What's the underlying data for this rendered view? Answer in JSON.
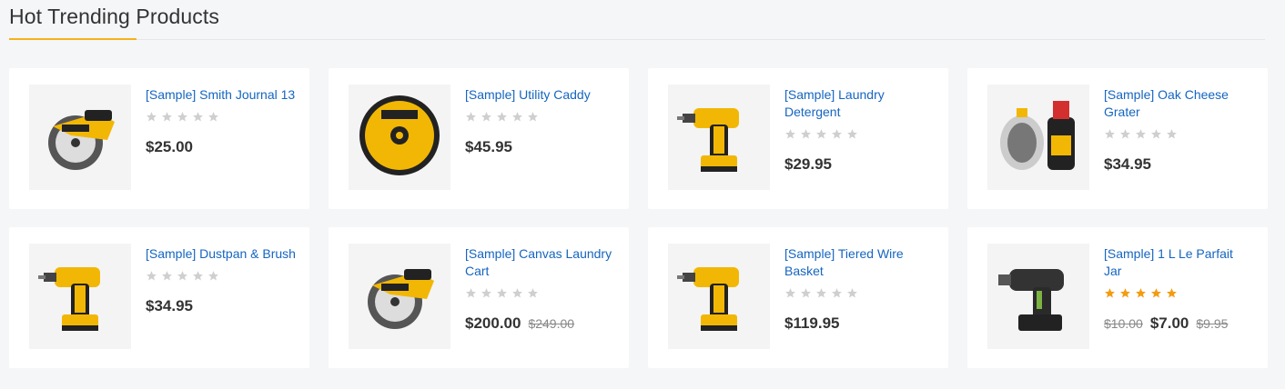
{
  "section": {
    "title": "Hot Trending Products",
    "accent_color": "#f5b21b"
  },
  "colors": {
    "link": "#1565c0",
    "star_empty": "#cfcfcf",
    "star_filled": "#f39c12"
  },
  "products": [
    {
      "name": "[Sample] Smith Journal 13",
      "rating": 0,
      "price": "$25.00",
      "old_price_before": "",
      "old_price_after": "",
      "image": "circular-saw-icon"
    },
    {
      "name": "[Sample] Utility Caddy",
      "rating": 0,
      "price": "$45.95",
      "old_price_before": "",
      "old_price_after": "",
      "image": "saw-blade-icon"
    },
    {
      "name": "[Sample] Laundry Detergent",
      "rating": 0,
      "price": "$29.95",
      "old_price_before": "",
      "old_price_after": "",
      "image": "hammer-drill-icon"
    },
    {
      "name": "[Sample] Oak Cheese Grater",
      "rating": 0,
      "price": "$34.95",
      "old_price_before": "",
      "old_price_after": "",
      "image": "chalk-line-icon"
    },
    {
      "name": "[Sample] Dustpan & Brush",
      "rating": 0,
      "price": "$34.95",
      "old_price_before": "",
      "old_price_after": "",
      "image": "hammer-drill-icon"
    },
    {
      "name": "[Sample] Canvas Laundry Cart",
      "rating": 0,
      "price": "$200.00",
      "old_price_before": "",
      "old_price_after": "$249.00",
      "image": "circular-saw-icon"
    },
    {
      "name": "[Sample] Tiered Wire Basket",
      "rating": 0,
      "price": "$119.95",
      "old_price_before": "",
      "old_price_after": "",
      "image": "hammer-drill-icon"
    },
    {
      "name": "[Sample] 1 L Le Parfait Jar",
      "rating": 5,
      "price": "$7.00",
      "old_price_before": "$10.00",
      "old_price_after": "$9.95",
      "image": "cordless-drill-icon"
    }
  ]
}
